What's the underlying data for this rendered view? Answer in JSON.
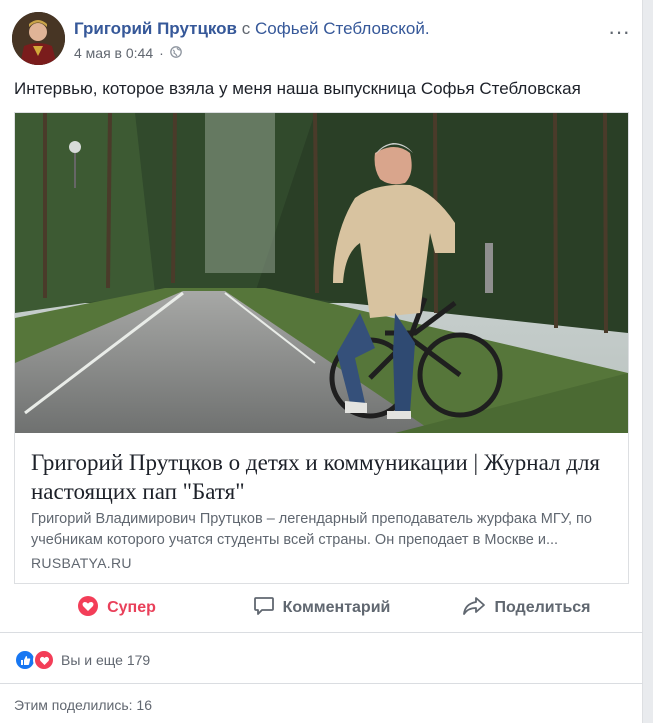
{
  "post": {
    "author": "Григорий Прутцков",
    "with_word": "с",
    "tagged": "Софьей Стебловской.",
    "date": "4 мая в 0:44",
    "audience_icon": "public-globe-icon",
    "menu_icon": "more-horizontal-icon",
    "text": "Интервью, которое взяла у меня наша выпускница Софья Стебловская"
  },
  "link": {
    "title": "Григорий Прутцков о детях и коммуникации | Журнал для настоящих пап \"Батя\"",
    "description": "Григорий Владимирович Прутцков – легендарный преподаватель журфака МГУ, по учебникам которого учатся студенты всей страны. Он преподает в Москве и...",
    "domain": "RUSBATYA.RU"
  },
  "actions": {
    "super_label": "Супер",
    "comment_label": "Комментарий",
    "share_label": "Поделиться"
  },
  "reactions": {
    "summary": "Вы и еще 179"
  },
  "shares": {
    "text": "Этим поделились: 16"
  },
  "colors": {
    "link_blue": "#365899",
    "super_red": "#e9405a",
    "muted": "#606770"
  }
}
